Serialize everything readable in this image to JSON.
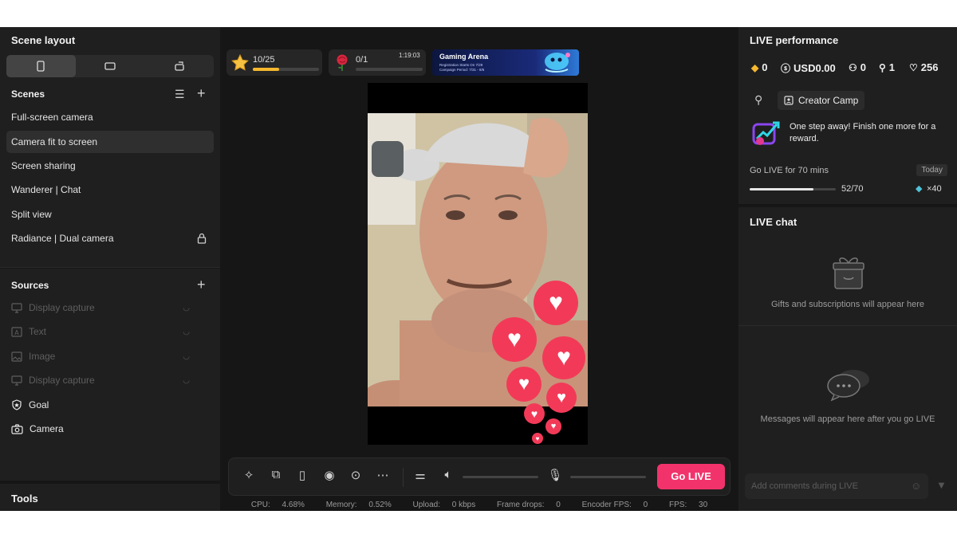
{
  "left": {
    "scene_layout_title": "Scene layout",
    "layout_options": [
      "portrait",
      "landscape",
      "rotate"
    ],
    "scenes_title": "Scenes",
    "scenes": [
      {
        "label": "Full-screen camera"
      },
      {
        "label": "Camera fit to screen",
        "active": true
      },
      {
        "label": "Screen sharing"
      },
      {
        "label": "Wanderer | Chat"
      },
      {
        "label": "Split view"
      },
      {
        "label": "Radiance | Dual camera",
        "locked": true
      }
    ],
    "sources_title": "Sources",
    "sources": [
      {
        "label": "Display capture",
        "icon": "monitor-icon",
        "enabled": false
      },
      {
        "label": "Text",
        "icon": "text-icon",
        "enabled": false
      },
      {
        "label": "Image",
        "icon": "image-icon",
        "enabled": false
      },
      {
        "label": "Display capture",
        "icon": "monitor-icon",
        "enabled": false
      },
      {
        "label": "Goal",
        "icon": "goal-icon",
        "enabled": true
      },
      {
        "label": "Camera",
        "icon": "camera-icon",
        "enabled": true
      }
    ],
    "tools_title": "Tools"
  },
  "center": {
    "goal_chip": {
      "value": "10/25",
      "progress": 0.4
    },
    "gift_chip": {
      "value": "0/1",
      "timer": "1:19:03",
      "progress": 0
    },
    "banner": {
      "title": "Gaming Arena",
      "line1": "Registration Starts On 7/29",
      "line2": "Campaign Period: 7/31 - 8/6"
    },
    "controls": {
      "go_live": "Go LIVE"
    },
    "stats": {
      "cpu_label": "CPU:",
      "cpu": "4.68%",
      "memory_label": "Memory:",
      "memory": "0.52%",
      "upload_label": "Upload:",
      "upload": "0 kbps",
      "frame_label": "Frame drops:",
      "frame": "0",
      "encoder_label": "Encoder FPS:",
      "encoder": "0",
      "fps_label": "FPS:",
      "fps": "30"
    }
  },
  "right": {
    "perf_title": "LIVE performance",
    "metrics": {
      "diamonds": "0",
      "usd": "USD0.00",
      "viewers": "0",
      "followers": "1",
      "likes": "256"
    },
    "creator_camp": "Creator Camp",
    "reward_text": "One step away! Finish one more for a reward.",
    "task_label": "Go LIVE for 70 mins",
    "task_tag": "Today",
    "task_progress": "52/70",
    "task_fraction": 0.743,
    "task_reward": "×40",
    "chat_title": "LIVE chat",
    "gifts_empty": "Gifts and subscriptions will appear here",
    "messages_empty": "Messages will appear here after you go LIVE",
    "comment_placeholder": "Add comments during LIVE"
  },
  "colors": {
    "accent": "#f2336b",
    "heart": "#f23a58",
    "goal": "#f5b82e",
    "panel": "#1f1f1f",
    "bg": "#161616"
  }
}
